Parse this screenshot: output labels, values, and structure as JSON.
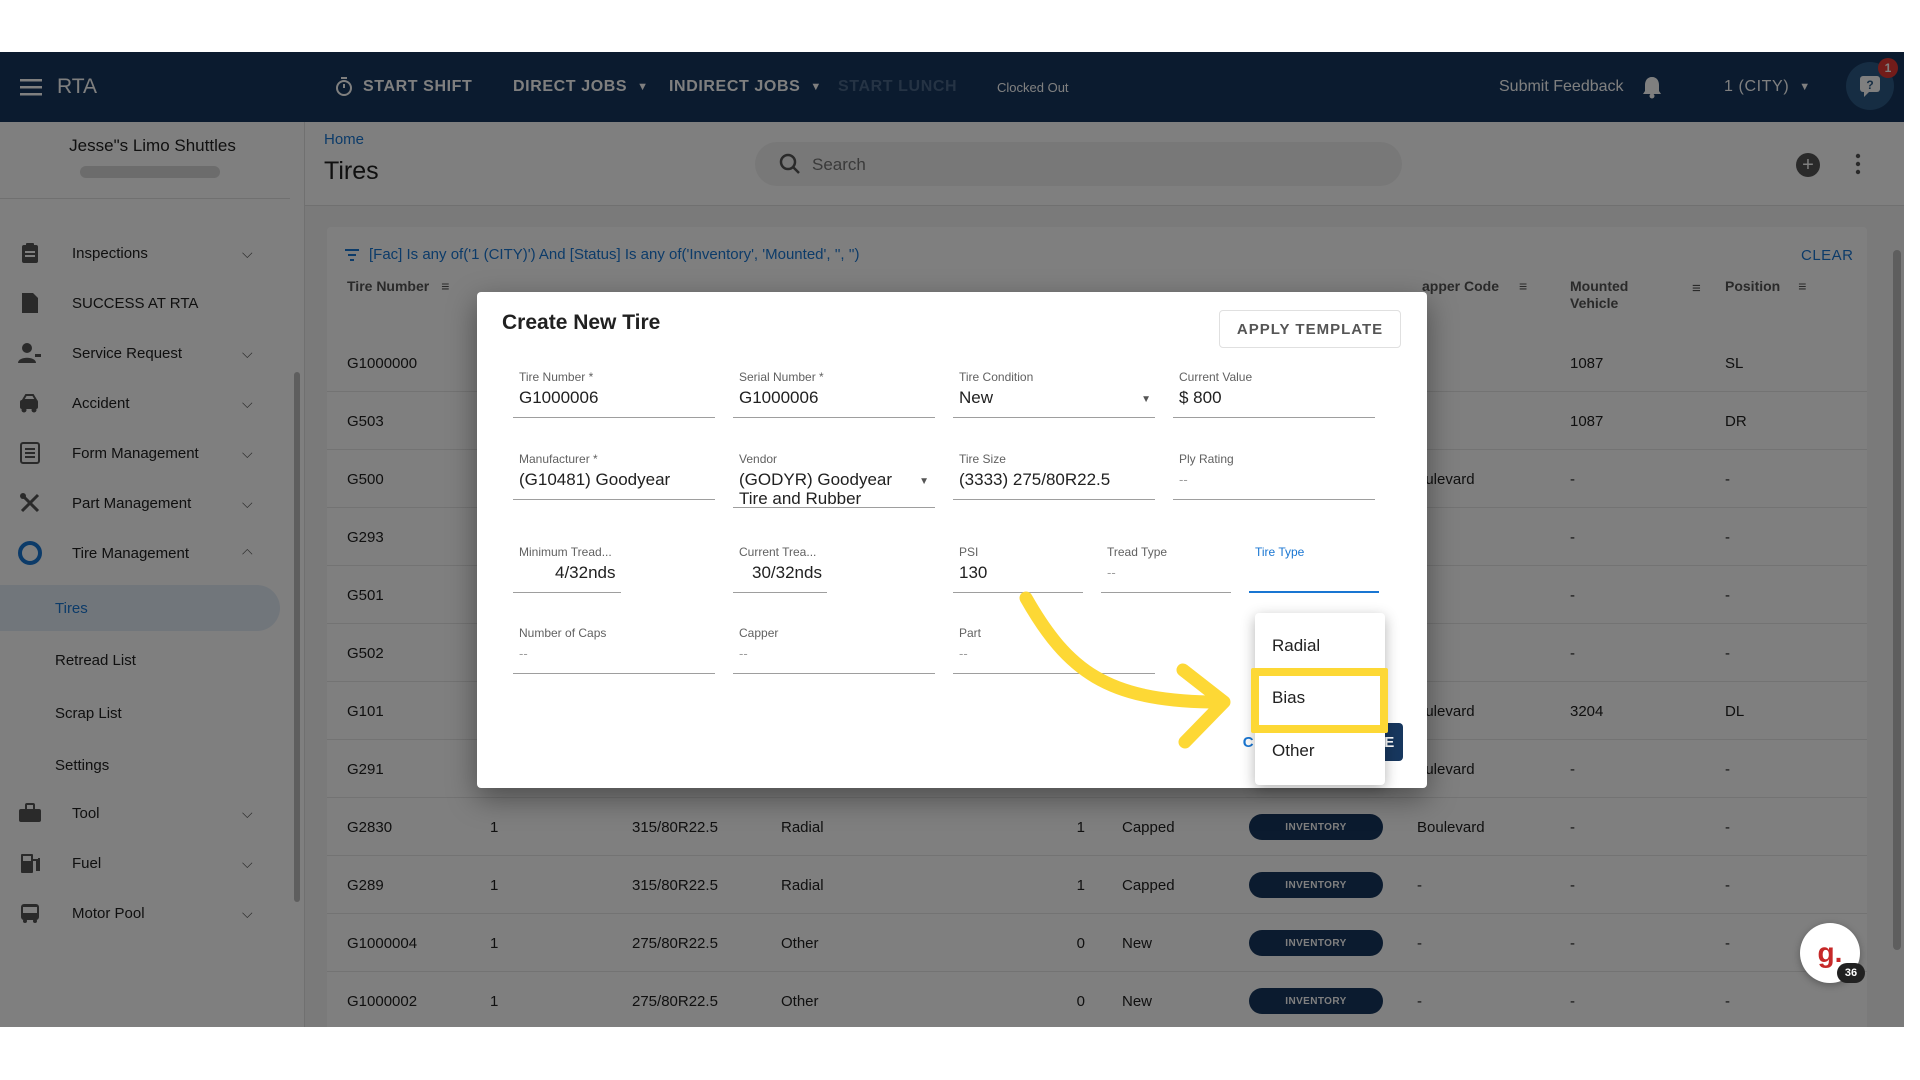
{
  "app": {
    "title": "RTA",
    "start_shift": "START SHIFT",
    "direct_jobs": "DIRECT JOBS",
    "indirect_jobs": "INDIRECT JOBS",
    "start_lunch": "START LUNCH",
    "clock_status": "Clocked Out",
    "submit_feedback": "Submit Feedback",
    "location": "1 (CITY)",
    "notification_count": "1",
    "colors": {
      "appbar": "#17375e",
      "accent": "#1976d2",
      "highlight": "#fdd835"
    }
  },
  "sidebar": {
    "company": "Jesse\"s Limo Shuttles",
    "items": [
      {
        "label": "Inspections",
        "icon": "clipboard-icon"
      },
      {
        "label": "SUCCESS AT RTA",
        "icon": "document-icon"
      },
      {
        "label": "Service Request",
        "icon": "person-wrench-icon"
      },
      {
        "label": "Accident",
        "icon": "car-crash-icon"
      },
      {
        "label": "Form Management",
        "icon": "form-icon"
      },
      {
        "label": "Part Management",
        "icon": "tools-icon"
      },
      {
        "label": "Tire Management",
        "icon": "tire-icon"
      },
      {
        "label": "Tool",
        "icon": "toolbox-icon"
      },
      {
        "label": "Fuel",
        "icon": "fuel-icon"
      },
      {
        "label": "Motor Pool",
        "icon": "bus-icon"
      }
    ],
    "tire_sub": [
      "Tires",
      "Retread List",
      "Scrap List",
      "Settings"
    ]
  },
  "page": {
    "breadcrumb": "Home",
    "title": "Tires",
    "search_placeholder": "Search",
    "filter_text": "[Fac] Is any of('1 (CITY)') And [Status] Is any of('Inventory', 'Mounted', '', '')",
    "clear": "CLEAR"
  },
  "table": {
    "headers": {
      "tire_number": "Tire Number",
      "capper_code": "apper Code",
      "mounted_vehicle": "Mounted Vehicle",
      "position": "Position"
    },
    "rows": [
      {
        "tire": "G1000000",
        "c2": "",
        "c3": "",
        "c4": "",
        "c5": "",
        "cond": "",
        "status": "",
        "capper": "",
        "vehicle": "1087",
        "pos": "SL"
      },
      {
        "tire": "G503",
        "c2": "",
        "c3": "",
        "c4": "",
        "c5": "",
        "cond": "",
        "status": "",
        "capper": "",
        "vehicle": "1087",
        "pos": "DR"
      },
      {
        "tire": "G500",
        "c2": "",
        "c3": "",
        "c4": "",
        "c5": "",
        "cond": "",
        "status": "",
        "capper": "oulevard",
        "vehicle": "-",
        "pos": "-"
      },
      {
        "tire": "G293",
        "c2": "",
        "c3": "",
        "c4": "",
        "c5": "",
        "cond": "",
        "status": "",
        "capper": "",
        "vehicle": "-",
        "pos": "-"
      },
      {
        "tire": "G501",
        "c2": "",
        "c3": "",
        "c4": "",
        "c5": "",
        "cond": "",
        "status": "",
        "capper": "",
        "vehicle": "-",
        "pos": "-"
      },
      {
        "tire": "G502",
        "c2": "",
        "c3": "",
        "c4": "",
        "c5": "",
        "cond": "",
        "status": "",
        "capper": "",
        "vehicle": "-",
        "pos": "-"
      },
      {
        "tire": "G101",
        "c2": "",
        "c3": "",
        "c4": "",
        "c5": "",
        "cond": "",
        "status": "",
        "capper": "oulevard",
        "vehicle": "3204",
        "pos": "DL"
      },
      {
        "tire": "G291",
        "c2": "",
        "c3": "",
        "c4": "",
        "c5": "",
        "cond": "",
        "status": "",
        "capper": "oulevard",
        "vehicle": "-",
        "pos": "-"
      },
      {
        "tire": "G2830",
        "c2": "1",
        "c3": "315/80R22.5",
        "c4": "Radial",
        "c5": "1",
        "cond": "Capped",
        "status": "INVENTORY",
        "capper": "Boulevard",
        "vehicle": "-",
        "pos": "-"
      },
      {
        "tire": "G289",
        "c2": "1",
        "c3": "315/80R22.5",
        "c4": "Radial",
        "c5": "1",
        "cond": "Capped",
        "status": "INVENTORY",
        "capper": "-",
        "vehicle": "-",
        "pos": "-"
      },
      {
        "tire": "G1000004",
        "c2": "1",
        "c3": "275/80R22.5",
        "c4": "Other",
        "c5": "0",
        "cond": "New",
        "status": "INVENTORY",
        "capper": "-",
        "vehicle": "-",
        "pos": "-"
      },
      {
        "tire": "G1000002",
        "c2": "1",
        "c3": "275/80R22.5",
        "c4": "Other",
        "c5": "0",
        "cond": "New",
        "status": "INVENTORY",
        "capper": "-",
        "vehicle": "-",
        "pos": "-"
      }
    ]
  },
  "dialog": {
    "title": "Create New Tire",
    "apply_template": "APPLY TEMPLATE",
    "cancel": "CANCEL",
    "create": "CREATE",
    "fields": {
      "tire_number": {
        "label": "Tire Number *",
        "value": "G1000006"
      },
      "serial_number": {
        "label": "Serial Number *",
        "value": "G1000006"
      },
      "tire_condition": {
        "label": "Tire Condition",
        "value": "New"
      },
      "current_value": {
        "label": "Current Value",
        "value": "$ 800"
      },
      "manufacturer": {
        "label": "Manufacturer *",
        "value": "(G10481) Goodyear"
      },
      "vendor": {
        "label": "Vendor",
        "value_line1": "(GODYR) Goodyear",
        "value_line2": "Tire and Rubber"
      },
      "tire_size": {
        "label": "Tire Size",
        "value": "(3333) 275/80R22.5"
      },
      "ply_rating": {
        "label": "Ply Rating",
        "placeholder": "--"
      },
      "minimum_tread": {
        "label": "Minimum Tread...",
        "value": "4/32nds"
      },
      "current_tread": {
        "label": "Current Trea...",
        "value": "30/32nds"
      },
      "psi": {
        "label": "PSI",
        "value": "130"
      },
      "tread_type": {
        "label": "Tread Type",
        "placeholder": "--"
      },
      "tire_type": {
        "label": "Tire Type"
      },
      "number_of_caps": {
        "label": "Number of Caps",
        "placeholder": "--"
      },
      "capper": {
        "label": "Capper",
        "placeholder": "--"
      },
      "part": {
        "label": "Part",
        "placeholder": "--"
      }
    },
    "tire_type_options": [
      "Radial",
      "Bias",
      "Other"
    ]
  },
  "widget": {
    "letter": "g.",
    "count": "36"
  }
}
